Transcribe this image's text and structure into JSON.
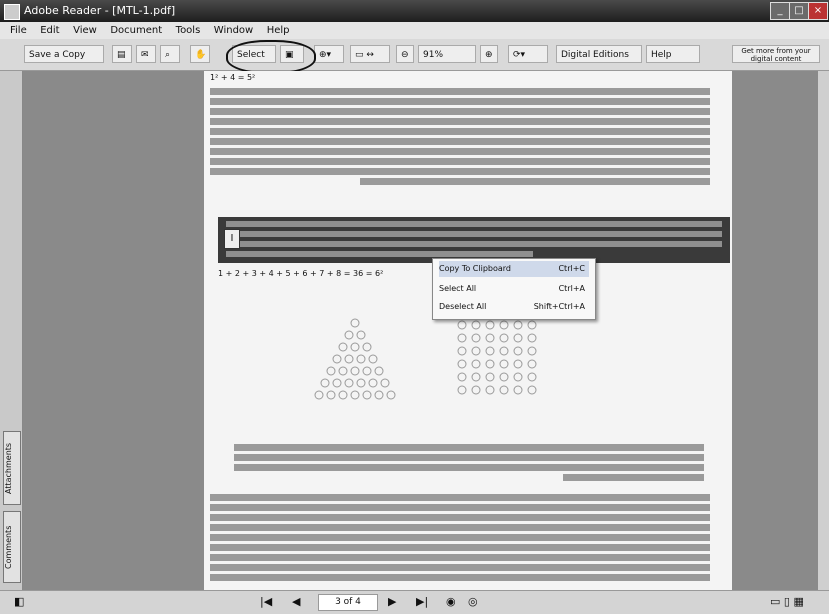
{
  "window": {
    "title": "Adobe Reader - [MTL-1.pdf]",
    "controls": [
      "_",
      "□",
      "×"
    ]
  },
  "menu": {
    "items": [
      "File",
      "Edit",
      "View",
      "Document",
      "Tools",
      "Window",
      "Help"
    ]
  },
  "toolbar": {
    "save_copy": "Save a Copy",
    "select": "Select",
    "zoom": "91%",
    "digital_editions": "Digital Editions",
    "help": "Help",
    "get_more": "Get more from your digital content"
  },
  "side_tabs": [
    "Comments",
    "Attachments"
  ],
  "page": {
    "equation_top": "1² + 4 = 5²",
    "equation_mid": "1 + 2 + 3 + 4 + 5 + 6 + 7 + 8 = 36 = 6²"
  },
  "context_menu": {
    "items": [
      {
        "label": "Copy To Clipboard",
        "shortcut": "Ctrl+C"
      },
      {
        "label": "Select All",
        "shortcut": "Ctrl+A"
      },
      {
        "label": "Deselect All",
        "shortcut": "Shift+Ctrl+A"
      }
    ]
  },
  "status": {
    "page": "3 of 4"
  }
}
